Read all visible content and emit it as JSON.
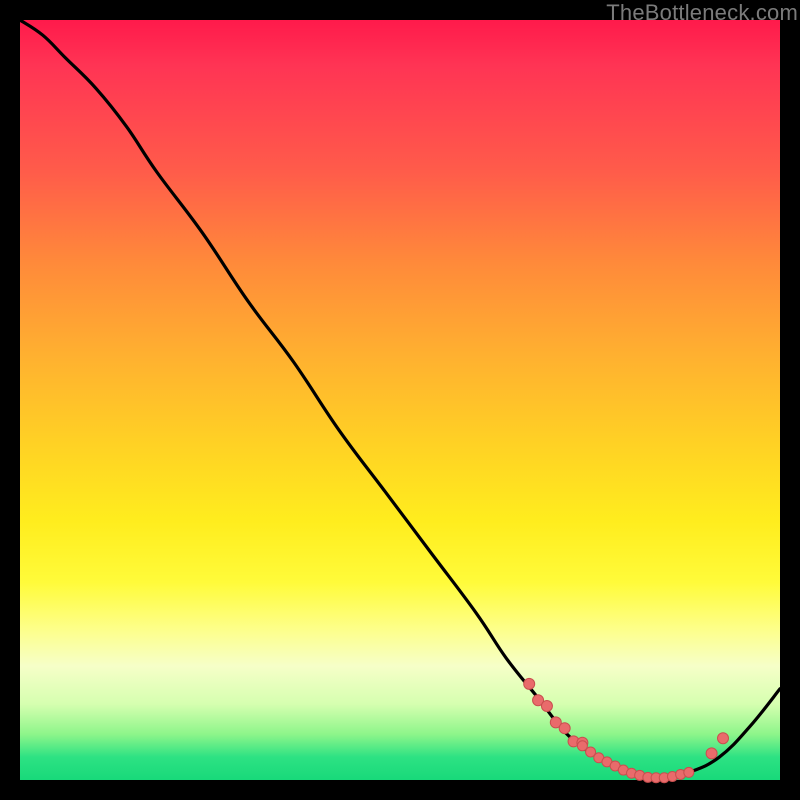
{
  "attribution": "TheBottleneck.com",
  "colors": {
    "curve": "#000000",
    "marker_fill": "#e96b6b",
    "marker_stroke": "#c94f4f"
  },
  "chart_data": {
    "type": "line",
    "title": "",
    "xlabel": "",
    "ylabel": "",
    "xlim": [
      0,
      100
    ],
    "ylim": [
      0,
      100
    ],
    "series": [
      {
        "name": "curve",
        "x": [
          0,
          3,
          6,
          10,
          14,
          18,
          24,
          30,
          36,
          42,
          48,
          54,
          60,
          64,
          68,
          72,
          76,
          80,
          84,
          88,
          92,
          96,
          100
        ],
        "y": [
          100,
          98,
          95,
          91,
          86,
          80,
          72,
          63,
          55,
          46,
          38,
          30,
          22,
          16,
          11,
          6,
          3,
          1,
          0,
          1,
          3,
          7,
          12
        ]
      }
    ],
    "markers": {
      "left_cluster": {
        "x_range": [
          67,
          74
        ],
        "y_range": [
          4,
          10
        ],
        "count": 7
      },
      "bottom_strip": {
        "x_range": [
          74,
          88
        ],
        "y_range": [
          0,
          1.5
        ],
        "count": 14
      },
      "right_pair": {
        "points": [
          [
            91,
            3.5
          ],
          [
            92.5,
            5.5
          ]
        ]
      }
    }
  }
}
